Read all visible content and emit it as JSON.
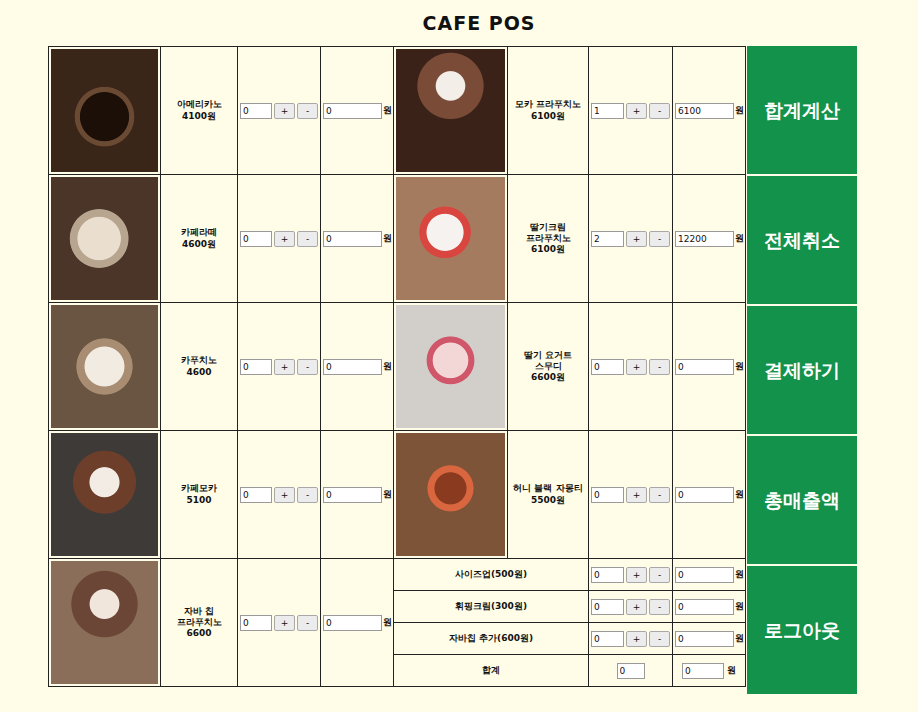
{
  "title": "CAFE POS",
  "controls": {
    "plus": "+",
    "minus": "-"
  },
  "left_menu": [
    {
      "name": "아메리카노",
      "price": "4100원",
      "qty": "0",
      "amount": "0",
      "unit": "원"
    },
    {
      "name": "카페라떼",
      "price": "4600원",
      "qty": "0",
      "amount": "0",
      "unit": "원"
    },
    {
      "name": "카푸치노",
      "price": "4600",
      "qty": "0",
      "amount": "0",
      "unit": "원"
    },
    {
      "name": "카페모카",
      "price": "5100",
      "qty": "0",
      "amount": "0",
      "unit": "원"
    },
    {
      "name": "자바 칩 프라푸치노",
      "price": "6600",
      "qty": "0",
      "amount": "0",
      "unit": "원"
    }
  ],
  "right_menu": [
    {
      "name": "모카 프라푸치노",
      "price": "6100원",
      "qty": "1",
      "amount": "6100",
      "unit": "원"
    },
    {
      "name": "딸기크림 프라푸치노",
      "price": "6100원",
      "qty": "2",
      "amount": "12200",
      "unit": "원"
    },
    {
      "name": "딸기 요거트 스무디",
      "price": "6600원",
      "qty": "0",
      "amount": "0",
      "unit": "원"
    },
    {
      "name": "허니 블랙 자몽티",
      "price": "5500원",
      "qty": "0",
      "amount": "0",
      "unit": "원"
    }
  ],
  "options": [
    {
      "label": "사이즈업(500원)",
      "qty": "0",
      "amount": "0",
      "unit": "원"
    },
    {
      "label": "휘핑크림(300원)",
      "qty": "0",
      "amount": "0",
      "unit": "원"
    },
    {
      "label": "자바칩 추가(600원)",
      "qty": "0",
      "amount": "0",
      "unit": "원"
    }
  ],
  "total": {
    "label": "합계",
    "qty": "0",
    "amount": "0",
    "unit": "원"
  },
  "buttons": [
    {
      "label": "합계계산"
    },
    {
      "label": "전체취소"
    },
    {
      "label": "결제하기"
    },
    {
      "label": "총매출액"
    },
    {
      "label": "로그아웃"
    }
  ]
}
